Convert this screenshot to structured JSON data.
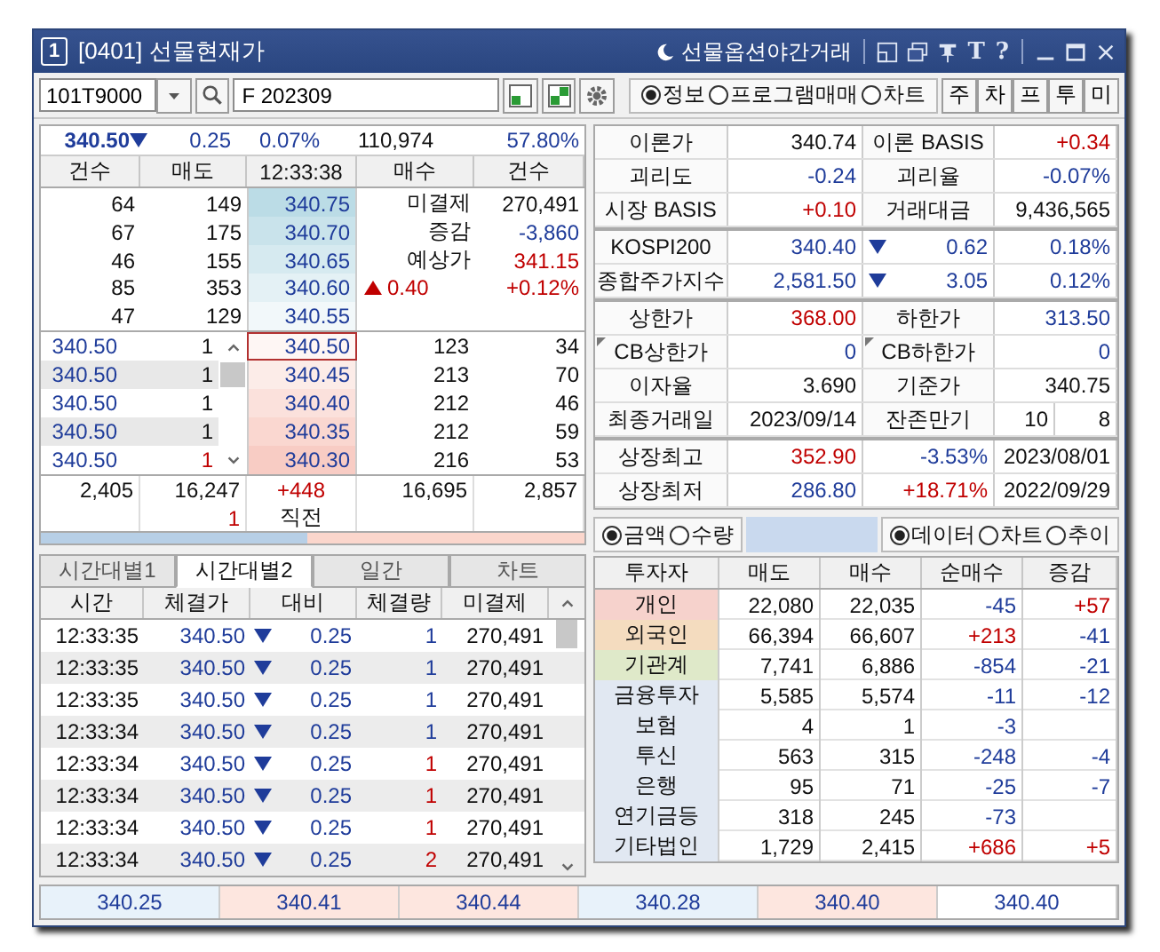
{
  "window": {
    "number": "1",
    "title": "[0401] 선물현재가",
    "night_link": "선물옵션야간거래",
    "glyph_buttons": [
      "T",
      "?"
    ]
  },
  "toolbar": {
    "code": "101T9000",
    "name": "F 202309",
    "radios": [
      {
        "label": "정보",
        "selected": true
      },
      {
        "label": "프로그램매매",
        "selected": false
      },
      {
        "label": "차트",
        "selected": false
      }
    ],
    "quick_buttons": [
      "주",
      "차",
      "프",
      "투",
      "미"
    ]
  },
  "quote": {
    "price": "340.50",
    "falling": true,
    "change": "0.25",
    "rate": "0.07%",
    "volume": "110,974",
    "ratio": "57.80%"
  },
  "orderbook": {
    "columns": [
      "건수",
      "매도",
      "12:33:38",
      "매수",
      "건수"
    ],
    "asks": [
      {
        "count": "64",
        "qty": "149",
        "price": "340.75"
      },
      {
        "count": "67",
        "qty": "175",
        "price": "340.70"
      },
      {
        "count": "46",
        "qty": "155",
        "price": "340.65"
      },
      {
        "count": "85",
        "qty": "353",
        "price": "340.60"
      },
      {
        "count": "47",
        "qty": "129",
        "price": "340.55"
      }
    ],
    "ask_info": [
      {
        "label": "미결제",
        "value": "270,491"
      },
      {
        "label": "증감",
        "value": "-3,860",
        "color": "#1f3c9a"
      },
      {
        "label": "예상가",
        "value": "341.15",
        "color": "#c00000"
      },
      {
        "kind": "change",
        "rising": true,
        "label": "0.40",
        "value": "+0.12%",
        "color": "#c00000"
      }
    ],
    "bids": [
      {
        "tick_price": "340.50",
        "tick_qty": {
          "text": "1"
        },
        "price": "340.50",
        "qty": "123",
        "count": "34",
        "selected": true
      },
      {
        "tick_price": "340.50",
        "tick_qty": {
          "text": "1"
        },
        "price": "340.45",
        "qty": "213",
        "count": "70",
        "selected": false
      },
      {
        "tick_price": "340.50",
        "tick_qty": {
          "text": "1"
        },
        "price": "340.40",
        "qty": "212",
        "count": "46",
        "selected": false
      },
      {
        "tick_price": "340.50",
        "tick_qty": {
          "text": "1"
        },
        "price": "340.35",
        "qty": "212",
        "count": "59",
        "selected": false
      },
      {
        "tick_price": "340.50",
        "tick_qty": {
          "text": "1",
          "color": "#c00000"
        },
        "price": "340.30",
        "qty": "216",
        "count": "53",
        "selected": false
      }
    ],
    "totals": {
      "ask_count": "2,405",
      "ask_qty": "16,247",
      "diff": "+448",
      "bid_qty": "16,695",
      "bid_count": "2,857",
      "last_qty": "1",
      "last_label": "직전"
    },
    "balance_bar": {
      "level": 0.49
    }
  },
  "tabs": [
    {
      "label": "시간대별1",
      "selected": false
    },
    {
      "label": "시간대별2",
      "selected": true
    },
    {
      "label": "일간",
      "selected": false
    },
    {
      "label": "차트",
      "selected": false
    }
  ],
  "ticks": {
    "columns": [
      "시간",
      "체결가",
      "대비",
      "체결량",
      "미결제"
    ],
    "rows": [
      {
        "time": "12:33:35",
        "price": "340.50",
        "falling": true,
        "change": "0.25",
        "qty": {
          "text": "1",
          "color": "#1f3c9a"
        },
        "oi": "270,491"
      },
      {
        "time": "12:33:35",
        "price": "340.50",
        "falling": true,
        "change": "0.25",
        "qty": {
          "text": "1",
          "color": "#1f3c9a"
        },
        "oi": "270,491"
      },
      {
        "time": "12:33:35",
        "price": "340.50",
        "falling": true,
        "change": "0.25",
        "qty": {
          "text": "1",
          "color": "#1f3c9a"
        },
        "oi": "270,491"
      },
      {
        "time": "12:33:34",
        "price": "340.50",
        "falling": true,
        "change": "0.25",
        "qty": {
          "text": "1",
          "color": "#1f3c9a"
        },
        "oi": "270,491"
      },
      {
        "time": "12:33:34",
        "price": "340.50",
        "falling": true,
        "change": "0.25",
        "qty": {
          "text": "1",
          "color": "#c00000"
        },
        "oi": "270,491"
      },
      {
        "time": "12:33:34",
        "price": "340.50",
        "falling": true,
        "change": "0.25",
        "qty": {
          "text": "1",
          "color": "#c00000"
        },
        "oi": "270,491"
      },
      {
        "time": "12:33:34",
        "price": "340.50",
        "falling": true,
        "change": "0.25",
        "qty": {
          "text": "1",
          "color": "#c00000"
        },
        "oi": "270,491"
      },
      {
        "time": "12:33:34",
        "price": "340.50",
        "falling": true,
        "change": "0.25",
        "qty": {
          "text": "2",
          "color": "#c00000"
        },
        "oi": "270,491"
      }
    ]
  },
  "info_sections": [
    [
      [
        {
          "kind": "label",
          "text": "이론가"
        },
        {
          "kind": "value",
          "text": "340.74"
        },
        {
          "kind": "label",
          "text": "이론 BASIS"
        },
        {
          "kind": "value",
          "text": "+0.34",
          "color": "#c00000"
        }
      ],
      [
        {
          "kind": "label",
          "text": "괴리도"
        },
        {
          "kind": "value",
          "text": "-0.24",
          "color": "#1f3c9a"
        },
        {
          "kind": "label",
          "text": "괴리율"
        },
        {
          "kind": "value",
          "text": "-0.07%",
          "color": "#1f3c9a"
        }
      ],
      [
        {
          "kind": "label",
          "text": "시장 BASIS"
        },
        {
          "kind": "value",
          "text": "+0.10",
          "color": "#c00000"
        },
        {
          "kind": "label",
          "text": "거래대금"
        },
        {
          "kind": "value",
          "text": "9,436,565"
        }
      ]
    ],
    [
      [
        {
          "kind": "label",
          "text": "KOSPI200"
        },
        {
          "kind": "value",
          "text": "340.40",
          "color": "#1f3c9a"
        },
        {
          "kind": "change",
          "text": "0.62",
          "color": "#1f3c9a",
          "falling": true
        },
        {
          "kind": "value",
          "text": "0.18%",
          "color": "#1f3c9a"
        }
      ],
      [
        {
          "kind": "label",
          "text": "종합주가지수"
        },
        {
          "kind": "value",
          "text": "2,581.50",
          "color": "#1f3c9a"
        },
        {
          "kind": "change",
          "text": "3.05",
          "color": "#1f3c9a",
          "falling": true
        },
        {
          "kind": "value",
          "text": "0.12%",
          "color": "#1f3c9a"
        }
      ]
    ],
    [
      [
        {
          "kind": "label",
          "text": "상한가"
        },
        {
          "kind": "value",
          "text": "368.00",
          "color": "#c00000"
        },
        {
          "kind": "label",
          "text": "하한가"
        },
        {
          "kind": "value",
          "text": "313.50",
          "color": "#1f3c9a"
        }
      ],
      [
        {
          "kind": "label",
          "text": "CB상한가",
          "flag": true
        },
        {
          "kind": "value",
          "text": "0",
          "color": "#1f3c9a"
        },
        {
          "kind": "label",
          "text": "CB하한가",
          "flag": true
        },
        {
          "kind": "value",
          "text": "0",
          "color": "#1f3c9a"
        }
      ],
      [
        {
          "kind": "label",
          "text": "이자율"
        },
        {
          "kind": "value",
          "text": "3.690"
        },
        {
          "kind": "label",
          "text": "기준가"
        },
        {
          "kind": "value",
          "text": "340.75"
        }
      ],
      [
        {
          "kind": "label",
          "text": "최종거래일"
        },
        {
          "kind": "value",
          "text": "2023/09/14"
        },
        {
          "kind": "label",
          "text": "잔존만기"
        },
        {
          "kind": "split",
          "texts": [
            "10",
            "8"
          ]
        }
      ]
    ],
    [
      [
        {
          "kind": "label",
          "text": "상장최고"
        },
        {
          "kind": "value",
          "text": "352.90",
          "color": "#c00000"
        },
        {
          "kind": "value",
          "text": "-3.53%",
          "color": "#1f3c9a"
        },
        {
          "kind": "value",
          "text": "2023/08/01"
        }
      ],
      [
        {
          "kind": "label",
          "text": "상장최저"
        },
        {
          "kind": "value",
          "text": "286.80",
          "color": "#1f3c9a"
        },
        {
          "kind": "value",
          "text": "+18.71%",
          "color": "#c00000"
        },
        {
          "kind": "value",
          "text": "2022/09/29"
        }
      ]
    ]
  ],
  "unit_radios": [
    {
      "label": "금액",
      "selected": true
    },
    {
      "label": "수량",
      "selected": false
    }
  ],
  "view_radios": [
    {
      "label": "데이터",
      "selected": true
    },
    {
      "label": "차트",
      "selected": false
    },
    {
      "label": "추이",
      "selected": false
    }
  ],
  "investors": {
    "columns": [
      "투자자",
      "매도",
      "매수",
      "순매수",
      "증감"
    ],
    "rows": [
      {
        "name": "개인",
        "color": "#f6d2cc",
        "sell": "22,080",
        "buy": "22,035",
        "net": {
          "text": "-45",
          "color": "#1f3c9a"
        },
        "delta": {
          "text": "+57",
          "color": "#c00000"
        }
      },
      {
        "name": "외국인",
        "color": "#f4dcbf",
        "sell": "66,394",
        "buy": "66,607",
        "net": {
          "text": "+213",
          "color": "#c00000"
        },
        "delta": {
          "text": "-41",
          "color": "#1f3c9a"
        }
      },
      {
        "name": "기관계",
        "color": "#dfe9c9",
        "sell": "7,741",
        "buy": "6,886",
        "net": {
          "text": "-854",
          "color": "#1f3c9a"
        },
        "delta": {
          "text": "-21",
          "color": "#1f3c9a"
        }
      },
      {
        "name": "금융투자",
        "color": "#e1e8f2",
        "sell": "5,585",
        "buy": "5,574",
        "net": {
          "text": "-11",
          "color": "#1f3c9a"
        },
        "delta": {
          "text": "-12",
          "color": "#1f3c9a"
        }
      },
      {
        "name": "보험",
        "color": "#e1e8f2",
        "sell": "4",
        "buy": "1",
        "net": {
          "text": "-3",
          "color": "#1f3c9a"
        }
      },
      {
        "name": "투신",
        "color": "#e1e8f2",
        "sell": "563",
        "buy": "315",
        "net": {
          "text": "-248",
          "color": "#1f3c9a"
        },
        "delta": {
          "text": "-4",
          "color": "#1f3c9a"
        }
      },
      {
        "name": "은행",
        "color": "#e1e8f2",
        "sell": "95",
        "buy": "71",
        "net": {
          "text": "-25",
          "color": "#1f3c9a"
        },
        "delta": {
          "text": "-7",
          "color": "#1f3c9a"
        }
      },
      {
        "name": "연기금등",
        "color": "#e1e8f2",
        "sell": "318",
        "buy": "245",
        "net": {
          "text": "-73",
          "color": "#1f3c9a"
        }
      },
      {
        "name": "기타법인",
        "color": "#e1e8f2",
        "sell": "1,729",
        "buy": "2,415",
        "net": {
          "text": "+686",
          "color": "#c00000"
        },
        "delta": {
          "text": "+5",
          "color": "#c00000"
        }
      }
    ]
  },
  "bottom_bar": [
    {
      "text": "340.25",
      "color": "#e8f2fa"
    },
    {
      "text": "340.41",
      "color": "#fde6df"
    },
    {
      "text": "340.44",
      "color": "#fde6df"
    },
    {
      "text": "340.28",
      "color": "#e8f2fa"
    },
    {
      "text": "340.40",
      "color": "#fde6df"
    },
    {
      "text": "340.40",
      "color": "#ffffff"
    }
  ]
}
